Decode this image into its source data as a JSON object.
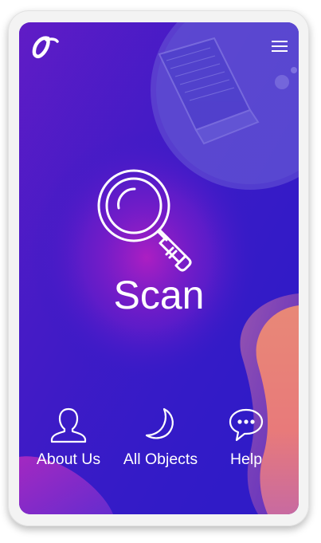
{
  "app": {
    "logo_icon": "stylized-o-logo",
    "menu_icon": "hamburger-menu-icon"
  },
  "main": {
    "scan_label": "Scan",
    "scan_icon": "magnifying-glass-icon"
  },
  "bottom_nav": [
    {
      "label": "About Us",
      "icon": "user-icon"
    },
    {
      "label": "All Objects",
      "icon": "crescent-moon-icon"
    },
    {
      "label": "Help",
      "icon": "chat-bubble-icon"
    }
  ],
  "colors": {
    "background": "#2f1bc7",
    "glow": "#9a1fc9",
    "accent_coral": "#f08a72",
    "text": "#ffffff"
  }
}
